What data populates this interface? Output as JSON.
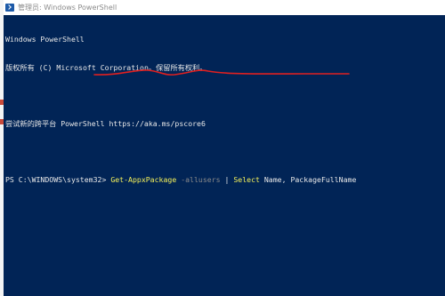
{
  "window": {
    "title": "管理员: Windows PowerShell",
    "icon": "powershell-icon"
  },
  "console": {
    "header_line1": "Windows PowerShell",
    "header_line2": "版权所有 (C) Microsoft Corporation。保留所有权利。",
    "header_line3": "尝试新的跨平台 PowerShell https://aka.ms/pscore6",
    "prompt": "PS C:\\WINDOWS\\system32> ",
    "command": {
      "cmdlet": "Get-AppxPackage",
      "param": " -allusers",
      "pipe": " | ",
      "cmdlet2": "Select",
      "args": " Name, PackageFullName"
    }
  },
  "colors": {
    "console_background": "#012456",
    "console_text": "#e8e8e8",
    "cmdlet": "#f4f059",
    "parameter": "#8a8a8a",
    "annotation": "#e02020"
  }
}
